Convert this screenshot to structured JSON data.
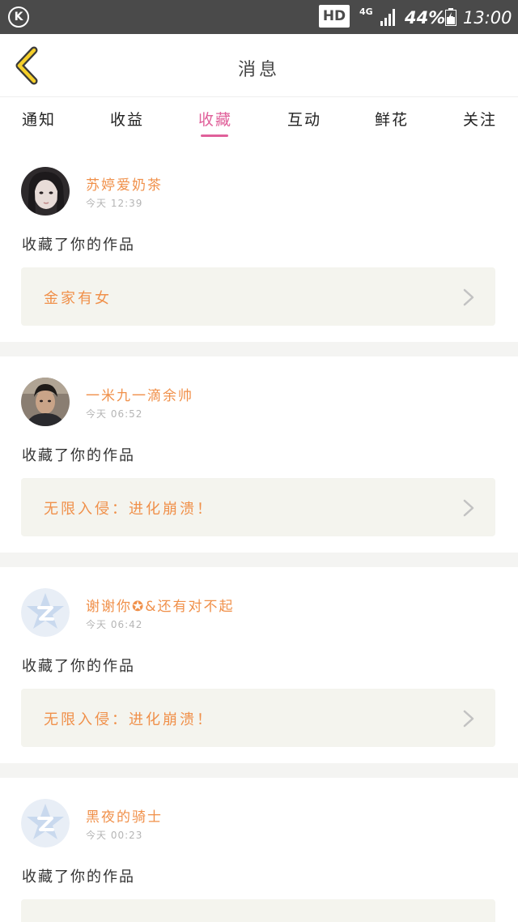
{
  "status_bar": {
    "hd": "HD",
    "network": "4G",
    "battery_percent": "44%",
    "time": "13:00"
  },
  "header": {
    "title": "消息"
  },
  "tabs": [
    {
      "label": "通知"
    },
    {
      "label": "收益"
    },
    {
      "label": "收藏",
      "active": true
    },
    {
      "label": "互动"
    },
    {
      "label": "鲜花"
    },
    {
      "label": "关注"
    }
  ],
  "colors": {
    "accent": "#e0609a",
    "name_orange": "#f0904a",
    "card_bg": "#f4f4ee"
  },
  "items": [
    {
      "username": "苏婷爱奶茶",
      "time": "今天 12:39",
      "action": "收藏了你的作品",
      "work": "金家有女",
      "avatar": "photo-girl"
    },
    {
      "username": "一米九一滴余帅",
      "time": "今天 06:52",
      "action": "收藏了你的作品",
      "work": "无限入侵：进化崩溃！",
      "avatar": "photo-boy"
    },
    {
      "username": "谢谢你✪&还有对不起",
      "time": "今天 06:42",
      "action": "收藏了你的作品",
      "work": "无限入侵：进化崩溃！",
      "avatar": "default-z-icon"
    },
    {
      "username": "黑夜的骑士",
      "time": "今天 00:23",
      "action": "收藏了你的作品",
      "work": "",
      "avatar": "default-z-icon"
    }
  ]
}
